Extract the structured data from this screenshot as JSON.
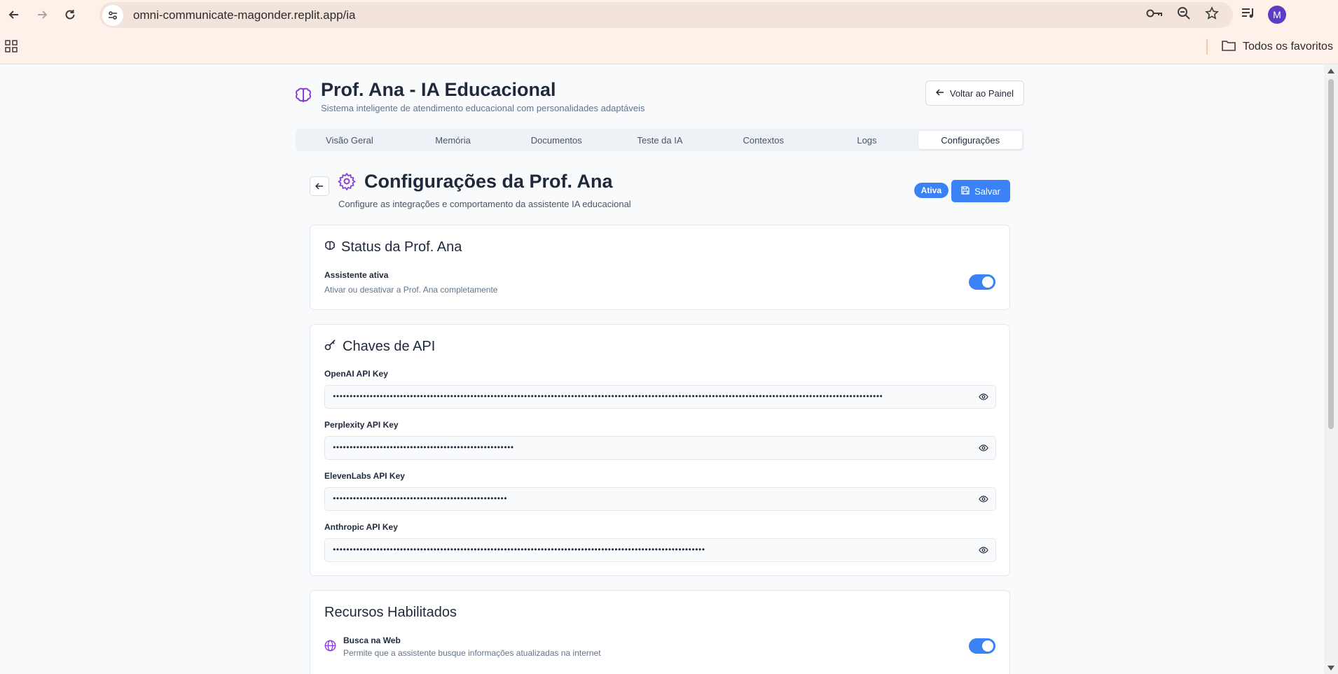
{
  "browser": {
    "url": "omni-communicate-magonder.replit.app/ia",
    "bookmarks_folder": "Todos os favoritos",
    "profile_initial": "M"
  },
  "header": {
    "title": "Prof. Ana - IA Educacional",
    "subtitle": "Sistema inteligente de atendimento educacional com personalidades adaptáveis",
    "back_button": "Voltar ao Painel"
  },
  "tabs": [
    {
      "label": "Visão Geral",
      "active": false
    },
    {
      "label": "Memória",
      "active": false
    },
    {
      "label": "Documentos",
      "active": false
    },
    {
      "label": "Teste da IA",
      "active": false
    },
    {
      "label": "Contextos",
      "active": false
    },
    {
      "label": "Logs",
      "active": false
    },
    {
      "label": "Configurações",
      "active": true
    }
  ],
  "settings": {
    "title": "Configurações da Prof. Ana",
    "subtitle": "Configure as integrações e comportamento da assistente IA educacional",
    "status_badge": "Ativa",
    "save_button": "Salvar"
  },
  "status_card": {
    "title": "Status da Prof. Ana",
    "label": "Assistente ativa",
    "description": "Ativar ou desativar a Prof. Ana completamente",
    "enabled": true
  },
  "api_keys_card": {
    "title": "Chaves de API",
    "keys": [
      {
        "label": "OpenAI API Key",
        "masked": "••••••••••••••••••••••••••••••••••••••••••••••••••••••••••••••••••••••••••••••••••••••••••••••••••••••••••••••••••••••••••••••••••••••••••••••••••••••••••••••••••••"
      },
      {
        "label": "Perplexity API Key",
        "masked": "••••••••••••••••••••••••••••••••••••••••••••••••••••••"
      },
      {
        "label": "ElevenLabs API Key",
        "masked": "••••••••••••••••••••••••••••••••••••••••••••••••••••"
      },
      {
        "label": "Anthropic API Key",
        "masked": "•••••••••••••••••••••••••••••••••••••••••••••••••••••••••••••••••••••••••••••••••••••••••••••••••••••••••••••••"
      }
    ]
  },
  "resources_card": {
    "title": "Recursos Habilitados",
    "items": [
      {
        "label": "Busca na Web",
        "description": "Permite que a assistente busque informações atualizadas na internet",
        "enabled": true
      }
    ]
  },
  "colors": {
    "accent": "#3b82f6",
    "brand_purple": "#8b3fd9"
  }
}
